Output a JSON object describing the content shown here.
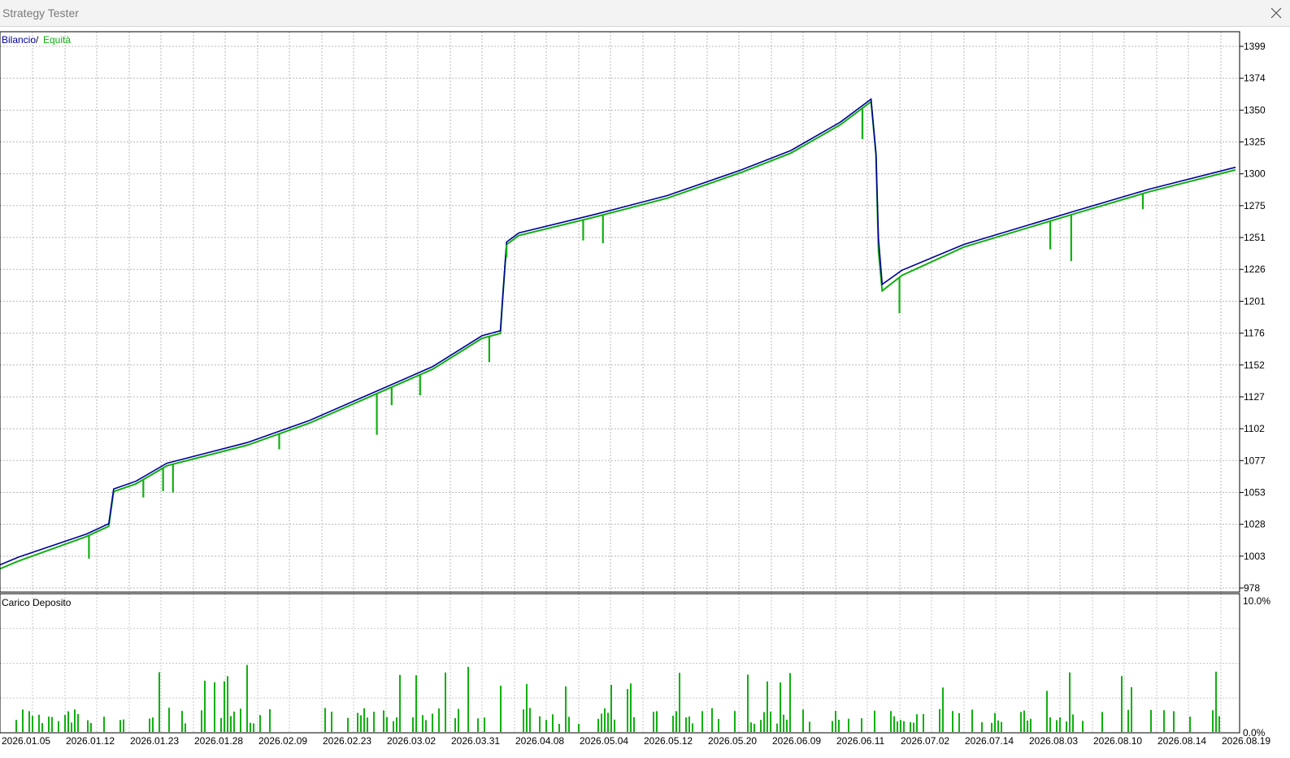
{
  "window": {
    "title": "Strategy Tester"
  },
  "legend": {
    "balance": "Bilancio",
    "separator": "/",
    "equity": "Equità"
  },
  "subchart": {
    "title": "Carico Deposito",
    "max_label": "10.0%",
    "min_label": "0.0%"
  },
  "colors": {
    "balance": "#000099",
    "equity": "#10b010",
    "load": "#10b010",
    "grid": "#b8b8b8",
    "axis": "#000000"
  },
  "icons": {
    "close": "close-icon"
  },
  "chart_data": {
    "type": "line",
    "y_ticks": [
      "1399",
      "1374",
      "1350",
      "1325",
      "1300",
      "1275",
      "1251",
      "1226",
      "1201",
      "1176",
      "1152",
      "1127",
      "1102",
      "1077",
      "1053",
      "1028",
      "1003",
      "978"
    ],
    "ylim": [
      978,
      1399
    ],
    "x_ticks": [
      "2026.01.05",
      "2026.01.12",
      "2026.01.23",
      "2026.01.28",
      "2026.02.09",
      "2026.02.23",
      "2026.03.02",
      "2026.03.31",
      "2026.04.08",
      "2026.05.04",
      "2026.05.12",
      "2026.05.20",
      "2026.06.09",
      "2026.06.11",
      "2026.07.02",
      "2026.07.14",
      "2026.08.03",
      "2026.08.10",
      "2026.08.14",
      "2026.08.19"
    ],
    "series": [
      {
        "name": "Bilancio",
        "points": [
          [
            0,
            996
          ],
          [
            0.015,
            1002
          ],
          [
            0.07,
            1020
          ],
          [
            0.088,
            1028
          ],
          [
            0.092,
            1055
          ],
          [
            0.11,
            1061
          ],
          [
            0.135,
            1075
          ],
          [
            0.2,
            1091
          ],
          [
            0.25,
            1108
          ],
          [
            0.3,
            1129
          ],
          [
            0.35,
            1150
          ],
          [
            0.39,
            1174
          ],
          [
            0.405,
            1178
          ],
          [
            0.407,
            1205
          ],
          [
            0.41,
            1247
          ],
          [
            0.42,
            1254
          ],
          [
            0.48,
            1268
          ],
          [
            0.54,
            1283
          ],
          [
            0.6,
            1303
          ],
          [
            0.64,
            1318
          ],
          [
            0.68,
            1340
          ],
          [
            0.705,
            1358
          ],
          [
            0.709,
            1315
          ],
          [
            0.711,
            1250
          ],
          [
            0.714,
            1214
          ],
          [
            0.73,
            1225
          ],
          [
            0.78,
            1245
          ],
          [
            0.87,
            1271
          ],
          [
            0.93,
            1288
          ],
          [
            1.0,
            1305
          ]
        ]
      },
      {
        "name": "Equità",
        "points": [
          [
            0,
            993
          ],
          [
            0.015,
            999
          ],
          [
            0.07,
            1018
          ],
          [
            0.088,
            1026
          ],
          [
            0.092,
            1053
          ],
          [
            0.11,
            1059
          ],
          [
            0.135,
            1073
          ],
          [
            0.2,
            1089
          ],
          [
            0.25,
            1106
          ],
          [
            0.3,
            1127
          ],
          [
            0.35,
            1148
          ],
          [
            0.39,
            1172
          ],
          [
            0.405,
            1176
          ],
          [
            0.407,
            1205
          ],
          [
            0.41,
            1245
          ],
          [
            0.42,
            1252
          ],
          [
            0.48,
            1266
          ],
          [
            0.54,
            1281
          ],
          [
            0.6,
            1301
          ],
          [
            0.64,
            1316
          ],
          [
            0.68,
            1338
          ],
          [
            0.705,
            1356
          ],
          [
            0.709,
            1315
          ],
          [
            0.711,
            1240
          ],
          [
            0.714,
            1209
          ],
          [
            0.73,
            1221
          ],
          [
            0.78,
            1243
          ],
          [
            0.87,
            1269
          ],
          [
            0.93,
            1286
          ],
          [
            1.0,
            1303
          ]
        ]
      }
    ],
    "load_series": {
      "name": "Carico Deposito",
      "ylim": [
        0,
        10
      ]
    }
  }
}
